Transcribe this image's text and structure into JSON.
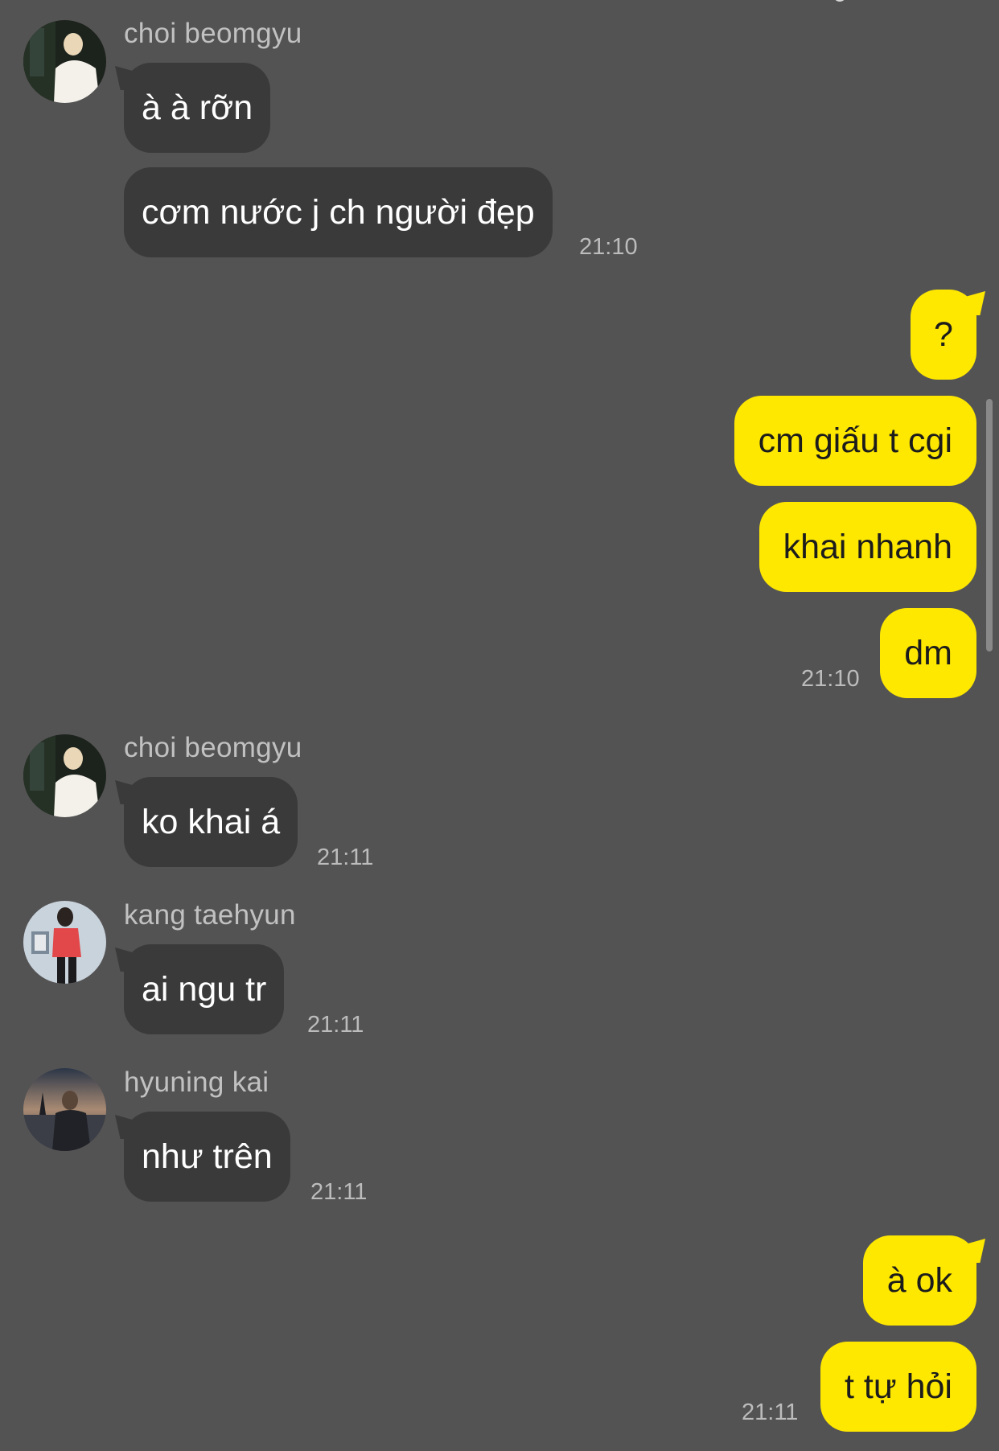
{
  "colors": {
    "background": "#545354",
    "incoming_bubble": "#3b3a3b",
    "outgoing_bubble": "#fee800",
    "incoming_text": "#ffffff",
    "outgoing_text": "#1c1c1c",
    "timestamp": "#bdbcbd",
    "sender_name": "#c2c1c2"
  },
  "chat": {
    "group1": {
      "sender": "choi beomgyu",
      "avatar": "profile-photo",
      "messages": [
        "à à rỡn",
        "cơm nước j ch người đẹp"
      ],
      "time": "21:10"
    },
    "group2": {
      "messages": [
        "?",
        "cm giấu t cgi",
        "khai nhanh",
        "dm"
      ],
      "time": "21:10"
    },
    "group3": {
      "sender": "choi beomgyu",
      "avatar": "profile-photo",
      "messages": [
        "ko khai á"
      ],
      "time": "21:11"
    },
    "group4": {
      "sender": "kang taehyun",
      "avatar": "profile-photo",
      "messages": [
        "ai ngu tr"
      ],
      "time": "21:11"
    },
    "group5": {
      "sender": "hyuning kai",
      "avatar": "profile-photo",
      "messages": [
        "như trên"
      ],
      "time": "21:11"
    },
    "group6": {
      "messages": [
        "à ok",
        "t tự hỏi"
      ],
      "time": "21:11"
    }
  }
}
